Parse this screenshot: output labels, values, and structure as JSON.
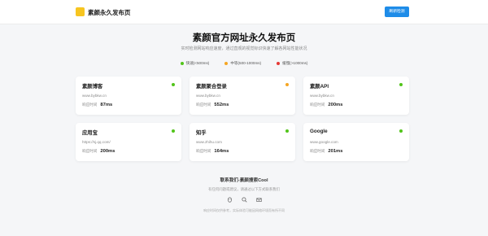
{
  "header": {
    "brand": "素颜永久发布页",
    "cta_label": "刷新检测",
    "logo_color": "#f7c520",
    "cta_color": "#1e8ce8"
  },
  "hero": {
    "title": "素颜官方网址永久发布页",
    "subtitle": "实时检测网站响应速度，通过直观的视觉标识快速了解各网站性能状况"
  },
  "legend": [
    {
      "label": "快速(<500ms)",
      "color": "#52c41a"
    },
    {
      "label": "中等(500-1000ms)",
      "color": "#f5a623"
    },
    {
      "label": "缓慢(>1000ms)",
      "color": "#e53935"
    }
  ],
  "response_label": "响应时间",
  "cards": [
    {
      "name": "素颜博客",
      "url": "www.bybkw.cn",
      "time": "87ms",
      "status_color": "#52c41a"
    },
    {
      "name": "素颜聚合登录",
      "url": "www.bybkw.cn",
      "time": "552ms",
      "status_color": "#f5a623"
    },
    {
      "name": "素颜API",
      "url": "www.bybkw.cn",
      "time": "200ms",
      "status_color": "#52c41a"
    },
    {
      "name": "应用宝",
      "url": "https://sj.qq.com/",
      "time": "200ms",
      "status_color": "#52c41a"
    },
    {
      "name": "知乎",
      "url": "www.zhihu.com",
      "time": "164ms",
      "status_color": "#52c41a"
    },
    {
      "name": "Google",
      "url": "www.google.com",
      "time": "201ms",
      "status_color": "#52c41a"
    }
  ],
  "footer": {
    "title": "联系我们-素颜搜索Cool",
    "subtitle": "有任何问题或建议，请通过以下方式联系我们",
    "icons": [
      "qq-icon",
      "search-icon",
      "mail-icon"
    ],
    "note": "响应时间仅供参考，实际体验可能因网络环境而有所不同"
  }
}
